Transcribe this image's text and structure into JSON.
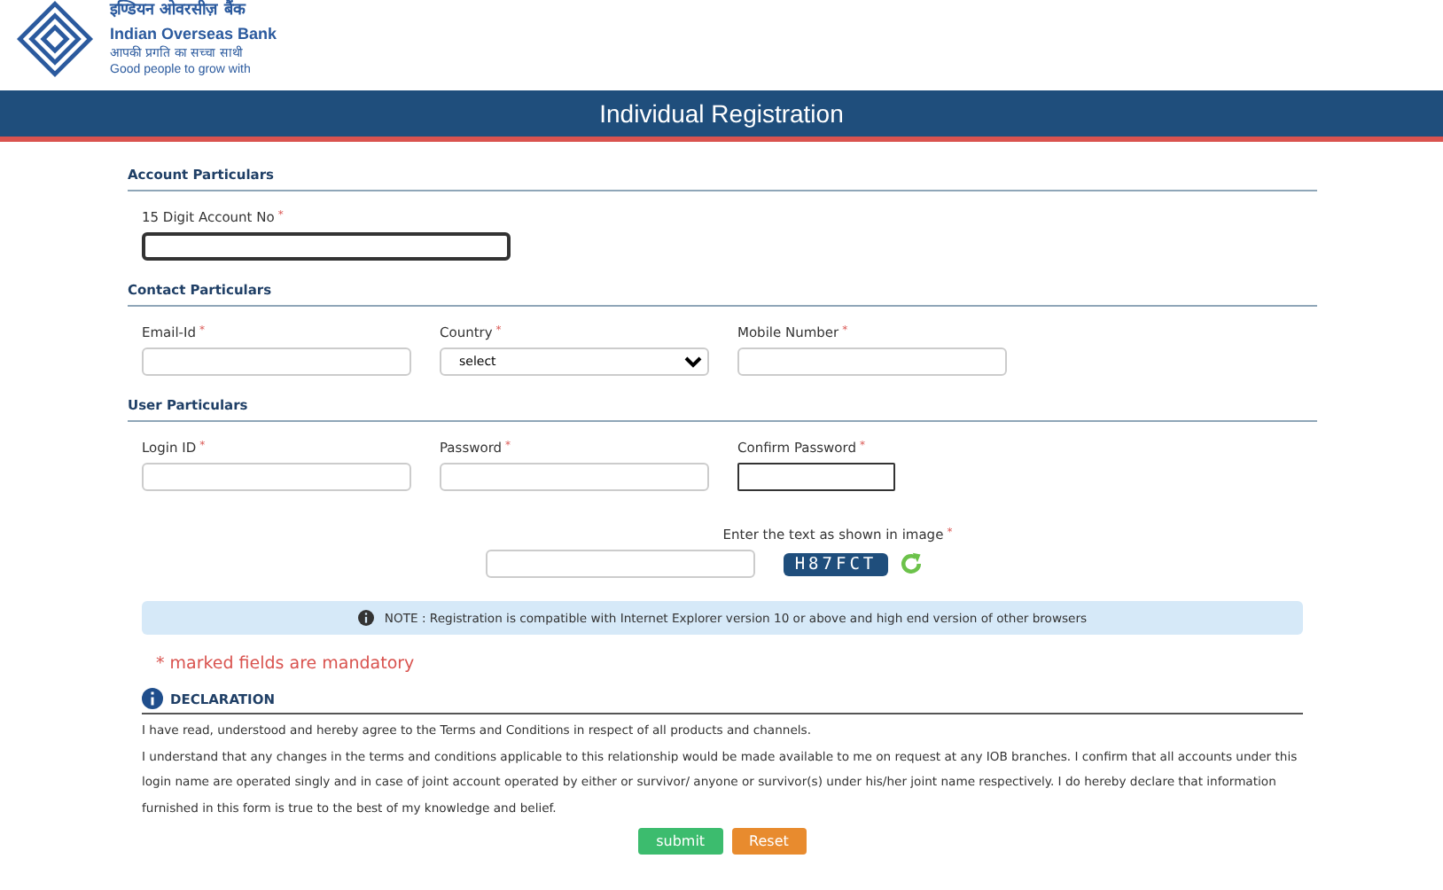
{
  "logo": {
    "hindi_name": "इण्डियन ओवरसीज़ बैंक",
    "name": "Indian Overseas Bank",
    "hindi_tagline": "आपकी प्रगति का सच्चा साथी",
    "tagline": "Good people to grow with"
  },
  "title": "Individual Registration",
  "sections": [
    {
      "heading": "Account Particulars",
      "fields": [
        {
          "label": "15 Digit Account No",
          "mark": "*",
          "kind": "text",
          "focused": true
        }
      ]
    },
    {
      "heading": "Contact Particulars",
      "fields": [
        {
          "label": "Email-Id",
          "mark": "*",
          "kind": "text",
          "focused": false
        },
        {
          "label": "Country",
          "mark": "*",
          "kind": "select",
          "value": "select",
          "focused": false
        },
        {
          "label": "Mobile Number",
          "mark": "*",
          "kind": "text",
          "focused": false
        }
      ]
    },
    {
      "heading": "User Particulars",
      "fields": [
        {
          "label": "Login ID",
          "mark": "*",
          "kind": "text",
          "focused": false
        },
        {
          "label": "Password",
          "mark": "*",
          "kind": "text",
          "focused": false
        },
        {
          "label": "Confirm Password",
          "mark": "*",
          "kind": "text",
          "focused": true
        }
      ]
    }
  ],
  "captcha": {
    "label": "Enter the text as shown in image",
    "mark": "*",
    "code": "H87FCT"
  },
  "note": "NOTE : Registration is compatible with Internet Explorer version 10 or above and high end version of other browsers",
  "mandatory": "* marked fields are mandatory",
  "declaration": {
    "heading": "DECLARATION",
    "paragraphs": [
      "I have read, understood and hereby agree to the Terms and Conditions in respect of all products and channels.",
      "I understand that any changes in the terms and conditions applicable to this relationship would be made available to me on request at any IOB branches. I confirm that all accounts under this login name are operated singly and in case of joint account operated by either or survivor/ anyone or survivor(s) under his/her joint name respectively. I do hereby declare that information furnished in this form is true to the best of my knowledge and belief."
    ]
  },
  "buttons": [
    {
      "label": "submit",
      "kind": "submit"
    },
    {
      "label": "Reset",
      "kind": "reset"
    }
  ]
}
